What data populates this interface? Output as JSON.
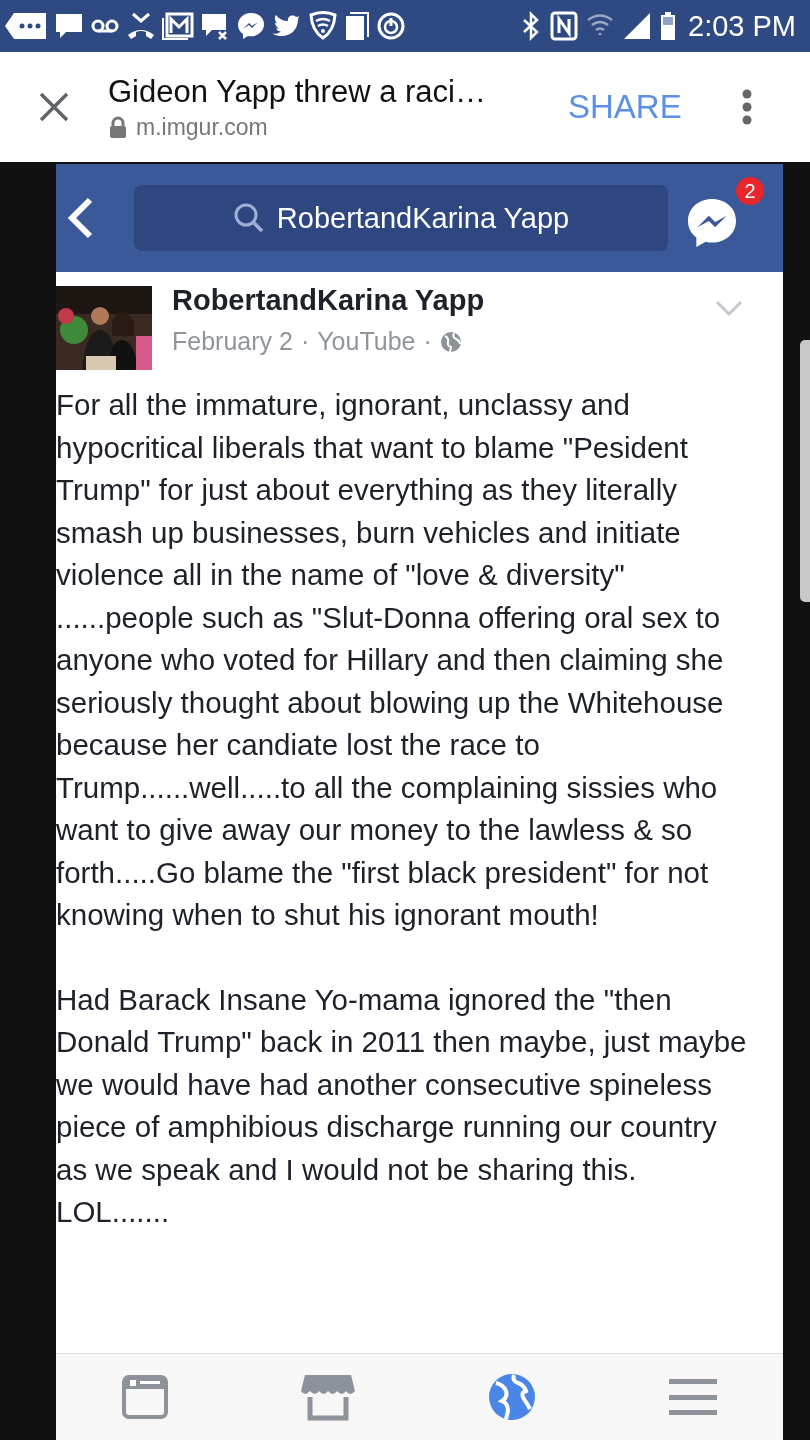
{
  "status_bar": {
    "time": "2:03 PM"
  },
  "browser": {
    "title": "Gideon Yapp threw a raci…",
    "url": "m.imgur.com",
    "share": "SHARE"
  },
  "app_header": {
    "search_value": "RobertandKarina Yapp",
    "messenger_badge": "2"
  },
  "post": {
    "author": "RobertandKarina Yapp",
    "date": "February 2",
    "separator_1": "·",
    "source": "YouTube",
    "separator_2": "·",
    "avatar": {
      "kind": "picture"
    },
    "paragraphs": [
      "For all the immature, ignorant, unclassy and hypocritical liberals that want to blame \"Pesident Trump\" for just about everything as they literally smash up businesses, burn vehicles and initiate violence all in the name of \"love & diversity\" ......people such as \"Slut-Donna offering oral sex to anyone who voted for Hillary and then claiming she seriously thought about blowing up the Whitehouse because her candiate lost the race to Trump......well.....to all the complaining sissies who want to give away our money to the lawless & so forth.....Go blame the \"first black president\" for not knowing when to shut his ignorant mouth!",
      "Had Barack Insane Yo-mama ignored the \"then Donald Trump\" back in 2011 then maybe, just maybe we would have had another consecutive spineless piece of amphibious discharge running our country as we speak and I would not be sharing this.",
      "LOL......."
    ]
  },
  "bottom_nav": [
    {
      "kind": "feed",
      "selected": false
    },
    {
      "kind": "marketplace",
      "selected": false
    },
    {
      "kind": "globe",
      "selected": true
    },
    {
      "kind": "menu",
      "selected": false
    }
  ]
}
